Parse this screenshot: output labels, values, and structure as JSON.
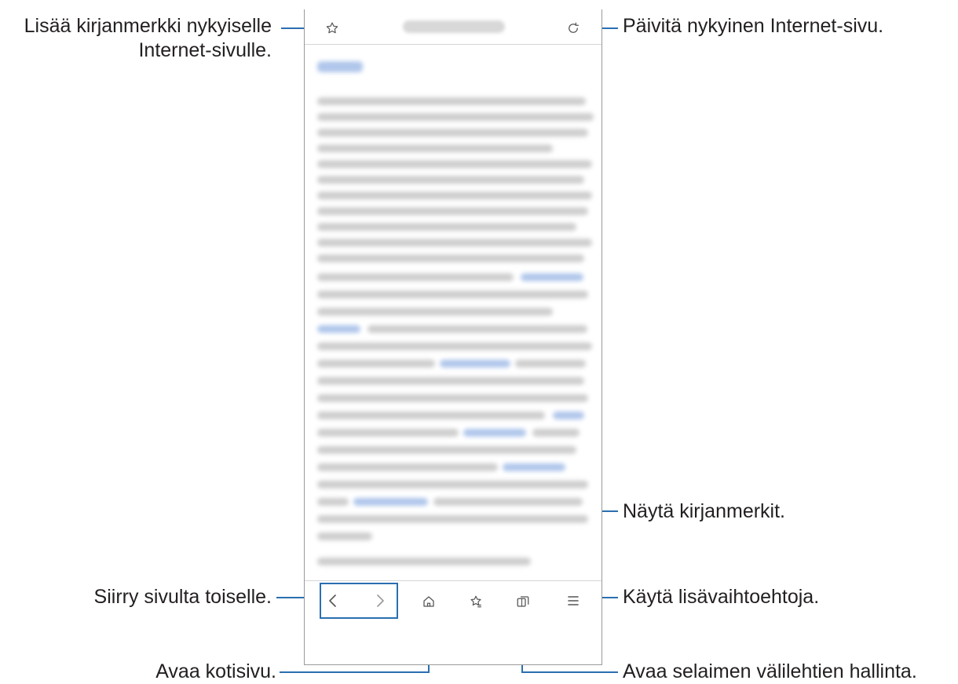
{
  "callouts": {
    "bookmark_add": {
      "line1": "Lisää kirjanmerkki nykyiselle",
      "line2": "Internet-sivulle."
    },
    "refresh": "Päivitä nykyinen Internet-sivu.",
    "bookmarks": "Näytä kirjanmerkit.",
    "navigate": "Siirry sivulta toiselle.",
    "more_options": "Käytä lisävaihtoehtoja.",
    "home": "Avaa kotisivu.",
    "tabs": "Avaa selaimen välilehtien hallinta."
  },
  "icons": {
    "bookmark_add": "star-outline-icon",
    "refresh": "refresh-icon",
    "back": "chevron-left-icon",
    "forward": "chevron-right-icon",
    "home": "home-icon",
    "bookmarks": "star-list-icon",
    "tabs": "tabs-icon",
    "menu": "menu-icon"
  },
  "colors": {
    "accent_line": "#2a6fb0",
    "frame": "#9a9a9a"
  }
}
